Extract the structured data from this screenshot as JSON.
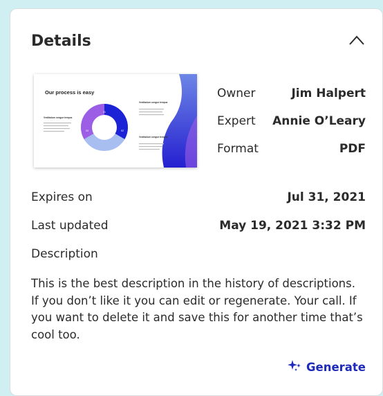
{
  "panel": {
    "title": "Details"
  },
  "thumbnail": {
    "heading": "Our process is easy",
    "step_labels": [
      "01",
      "02",
      "03"
    ],
    "caption_title": "Vestibulum congue tempus",
    "colors": {
      "dark_blue": "#1c22d6",
      "light_blue": "#a8bdf0",
      "purple": "#9d5ee6",
      "gradient_top": "#6d86e6",
      "gradient_bottom": "#2520d0"
    }
  },
  "meta": [
    {
      "label": "Owner",
      "value": "Jim Halpert"
    },
    {
      "label": "Expert",
      "value": "Annie O’Leary"
    },
    {
      "label": "Format",
      "value": "PDF"
    }
  ],
  "rows": {
    "expires_label": "Expires on",
    "expires_value": "Jul 31, 2021",
    "updated_label": "Last updated",
    "updated_value": "May 19, 2021 3:32 PM",
    "description_label": "Description"
  },
  "description": {
    "lines": [
      "This is the best description in the history of descriptions.",
      "If you don’t like it you can edit or regenerate. Your call. If",
      "you want to delete it and save this for another time that’s",
      "cool too."
    ]
  },
  "actions": {
    "generate_label": "Generate",
    "accent_color": "#1f2bb8"
  },
  "icons": {
    "collapse": "chevron-up-icon",
    "generate": "sparkle-icon"
  }
}
